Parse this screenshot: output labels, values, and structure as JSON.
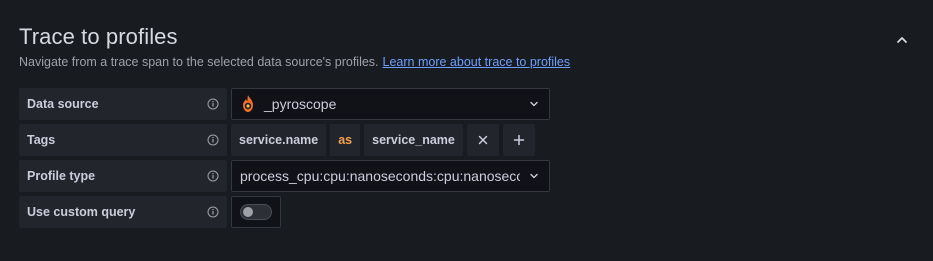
{
  "section": {
    "title": "Trace to profiles",
    "description": "Navigate from a trace span to the selected data source's profiles.",
    "learn_more": "Learn more about trace to profiles"
  },
  "rows": {
    "data_source": {
      "label": "Data source",
      "value": "_pyroscope",
      "icon": "pyroscope-logo-icon"
    },
    "tags": {
      "label": "Tags",
      "key": "service.name",
      "as": "as",
      "value": "service_name"
    },
    "profile_type": {
      "label": "Profile type",
      "value": "process_cpu:cpu:nanoseconds:cpu:nanoseconds"
    },
    "custom_query": {
      "label": "Use custom query",
      "enabled": false
    }
  },
  "colors": {
    "background": "#181b1f",
    "label_bg": "#22252b",
    "link": "#6e9fff",
    "as_keyword": "#f5a051"
  }
}
